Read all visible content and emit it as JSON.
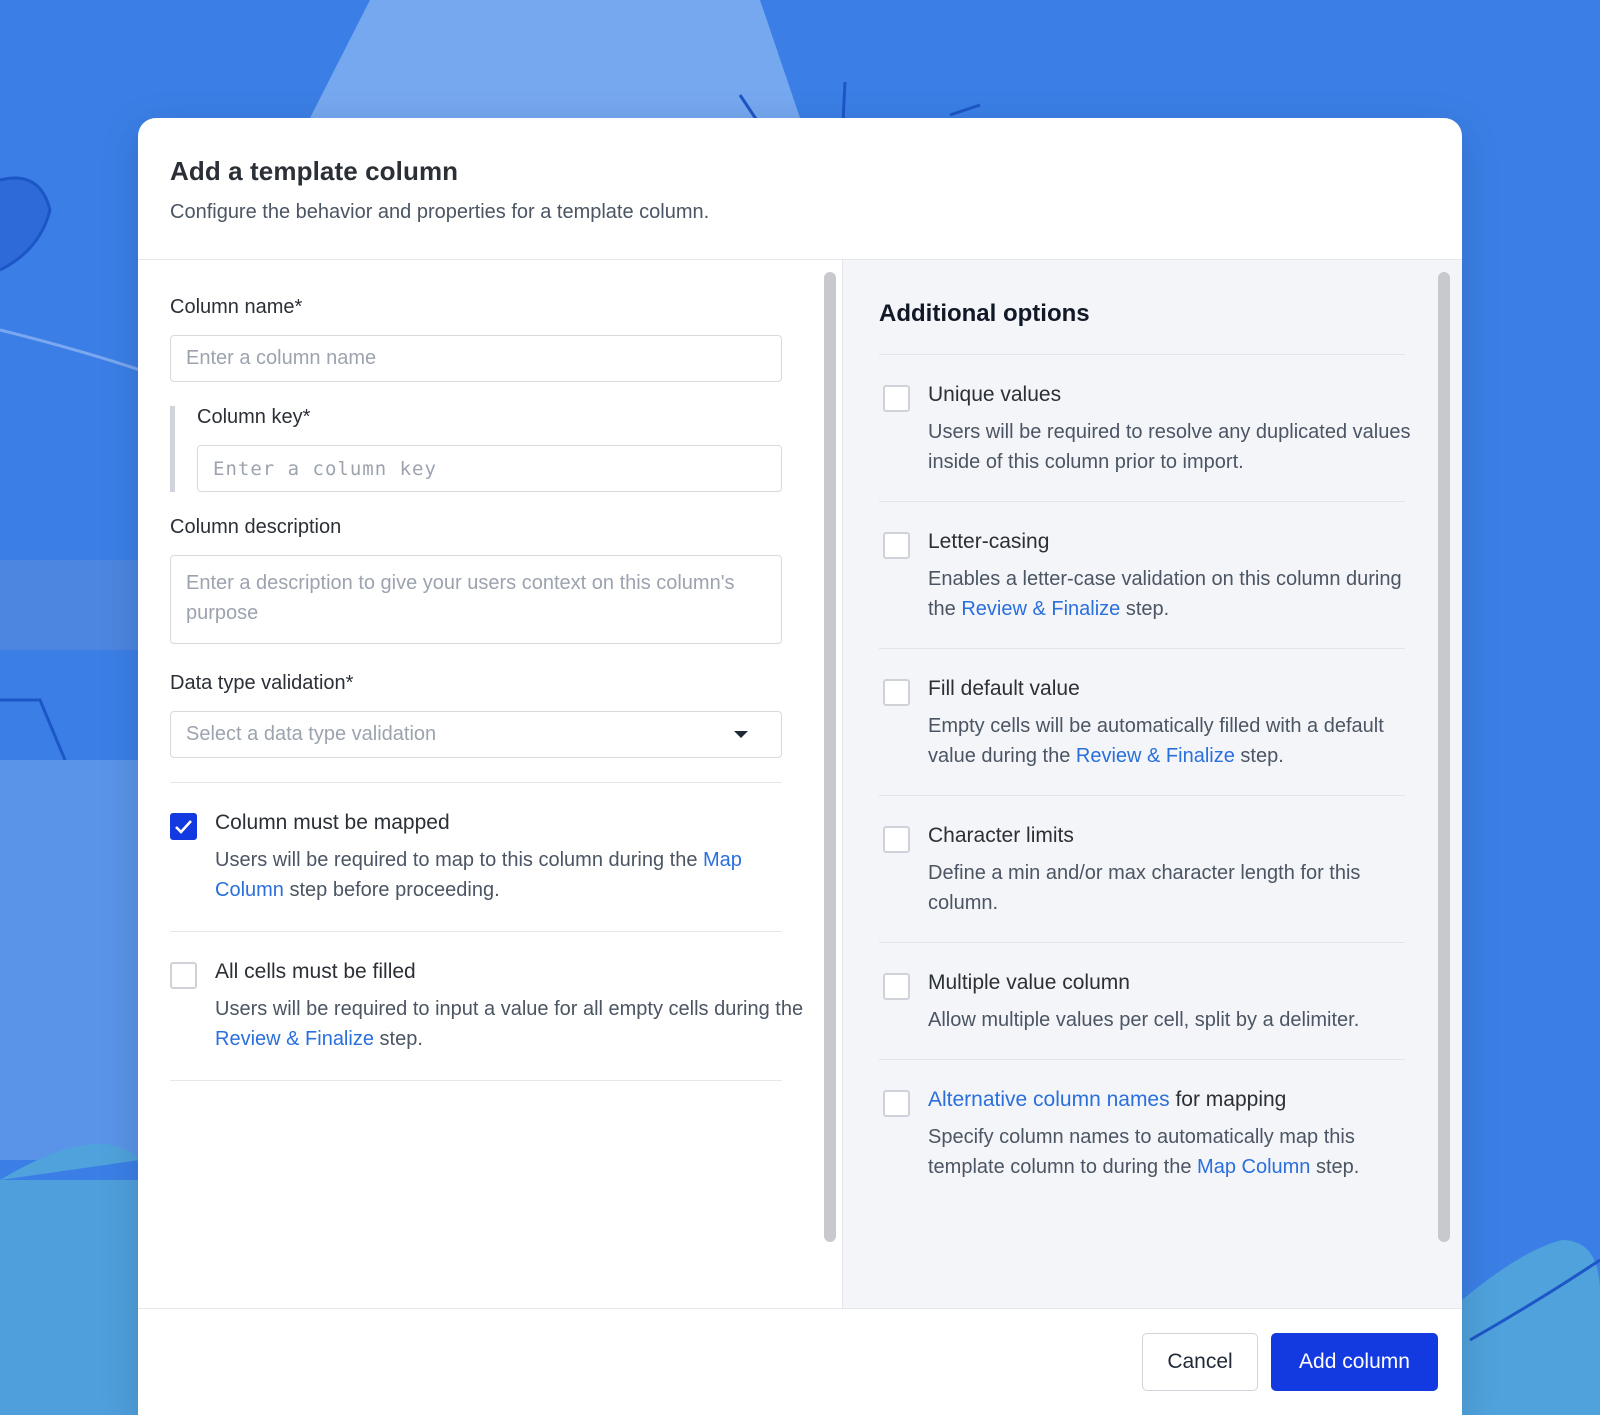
{
  "modal": {
    "title": "Add a template column",
    "subtitle": "Configure the behavior and properties for a template column."
  },
  "form": {
    "column_name": {
      "label": "Column name*",
      "placeholder": "Enter a column name"
    },
    "column_key": {
      "label": "Column key*",
      "placeholder": "Enter a column key"
    },
    "column_description": {
      "label": "Column description",
      "placeholder": "Enter a description to give your users context on this column's purpose"
    },
    "data_type": {
      "label": "Data type validation*",
      "placeholder": "Select a data type validation"
    }
  },
  "left_options": [
    {
      "title": "Column must be mapped",
      "checked": true,
      "desc_before": "Users will be required to map to this column during the ",
      "desc_link": "Map Column",
      "desc_after": " step before proceeding."
    },
    {
      "title": "All cells must be filled",
      "checked": false,
      "desc_before": "Users will be required to input a value for all empty cells during the ",
      "desc_link": "Review & Finalize",
      "desc_after": " step."
    }
  ],
  "right_panel": {
    "title": "Additional options",
    "options": [
      {
        "title": "Unique values",
        "desc": "Users will be required to resolve any duplicated values inside of this column prior to import."
      },
      {
        "title": "Letter-casing",
        "desc_before": "Enables a letter-case validation on this column during the ",
        "desc_link": "Review & Finalize",
        "desc_after": " step."
      },
      {
        "title": "Fill default value",
        "desc_before": "Empty cells will be automatically filled with a default value during the ",
        "desc_link": "Review & Finalize",
        "desc_after": " step."
      },
      {
        "title": "Character limits",
        "desc": "Define a min and/or max character length for this column."
      },
      {
        "title": "Multiple value column",
        "desc": "Allow multiple values per cell, split by a delimiter."
      },
      {
        "title_link": "Alternative column names",
        "title_after": " for mapping",
        "desc_before": "Specify column names to automatically map this template column to during the ",
        "desc_link": "Map Column",
        "desc_after": " step."
      }
    ]
  },
  "footer": {
    "cancel_label": "Cancel",
    "submit_label": "Add column"
  },
  "colors": {
    "primary": "#1339e0",
    "link": "#2a6fdc",
    "background": "#3b7fe6"
  }
}
